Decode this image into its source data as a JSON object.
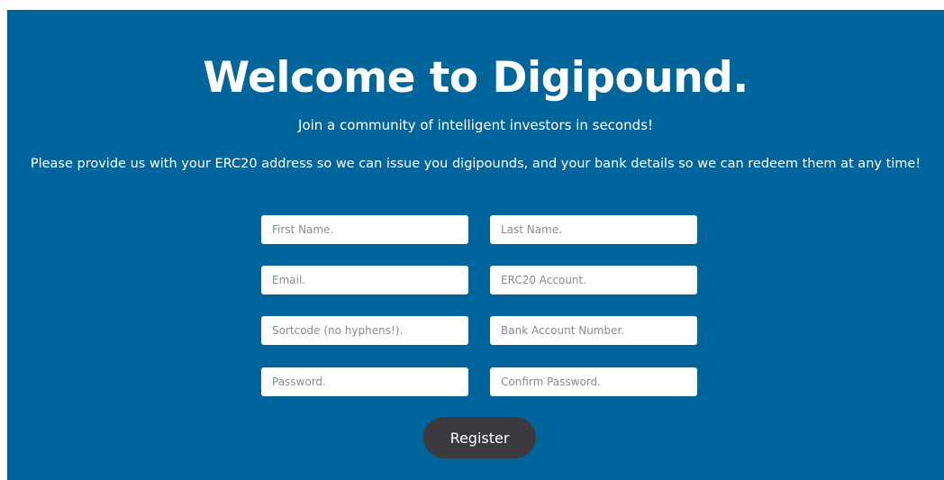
{
  "header": {
    "title": "Welcome to Digipound.",
    "subtitle": "Join a community of intelligent investors in seconds!",
    "description": "Please provide us with your ERC20 address so we can issue you digipounds, and your bank details so we can redeem them at any time!"
  },
  "form": {
    "first_name": {
      "placeholder": "First Name.",
      "value": ""
    },
    "last_name": {
      "placeholder": "Last Name.",
      "value": ""
    },
    "email": {
      "placeholder": "Email.",
      "value": ""
    },
    "erc20_account": {
      "placeholder": "ERC20 Account.",
      "value": ""
    },
    "sortcode": {
      "placeholder": "Sortcode (no hyphens!).",
      "value": ""
    },
    "bank_account_number": {
      "placeholder": "Bank Account Number.",
      "value": ""
    },
    "password": {
      "placeholder": "Password.",
      "value": ""
    },
    "confirm_password": {
      "placeholder": "Confirm Password.",
      "value": ""
    },
    "register_label": "Register"
  },
  "colors": {
    "background": "#00659a",
    "text": "#ffffff",
    "button": "#3a3a3f",
    "input_background": "#ffffff"
  }
}
